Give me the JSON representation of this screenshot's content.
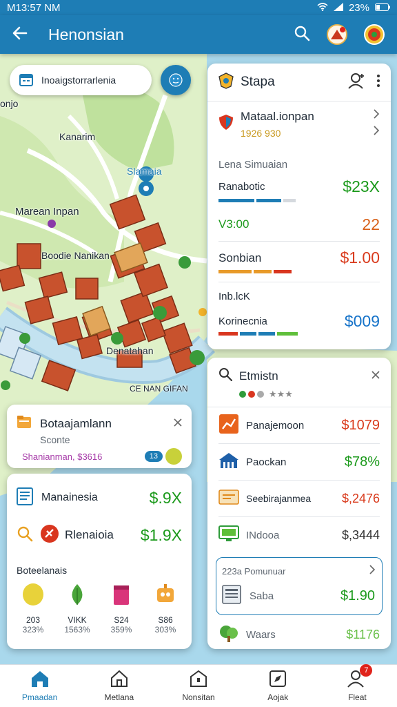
{
  "status_bar": {
    "time": "M13:57 NM",
    "battery": "23%"
  },
  "app_bar": {
    "title": "Henonsian"
  },
  "map": {
    "search_text": "Inoaigstorrarlenia",
    "labels": [
      "onjo",
      "Kanarim",
      "Slamaia",
      "Marean Inpan",
      "Boodie Nanikan",
      "Denatahan",
      "CE NAN GIFAN"
    ]
  },
  "stapa_card": {
    "title": "Stapa",
    "item_title": "Mataal.ionpan",
    "item_sub": "1926 930",
    "section": "Lena Simuaian",
    "rows": [
      {
        "label": "Ranabotic",
        "value": "$23X"
      },
      {
        "label": "V3:00",
        "value": "22"
      },
      {
        "label": "Sonbian",
        "value": "$1.00"
      },
      {
        "label": "Inb.lcK",
        "value": ""
      },
      {
        "label": "Korinecnia",
        "value": "$009"
      }
    ]
  },
  "info_card": {
    "title": "Botaajamlann",
    "subtitle": "Sconte",
    "link": "Shanianman, $3616",
    "badge": "13"
  },
  "bottom_left_card": {
    "rows": [
      {
        "label": "Manainesia",
        "value": "$.9X"
      },
      {
        "label": "Rlenaioia",
        "value": "$1.9X"
      }
    ],
    "section": "Boteelanais",
    "stats": [
      {
        "label": "203",
        "value": "323%"
      },
      {
        "label": "VIKK",
        "value": "1563%"
      },
      {
        "label": "S24",
        "value": "359%"
      },
      {
        "label": "S86",
        "value": "303%"
      }
    ]
  },
  "etmistn_card": {
    "title": "Etmistn",
    "items": [
      {
        "label": "Panajemoon",
        "value": "$1079"
      },
      {
        "label": "Paockan",
        "value": "$78%"
      },
      {
        "label": "Seebirajanmea",
        "value": "$,2476"
      },
      {
        "label": "INdooa",
        "value": "$,3444"
      }
    ],
    "sub_title": "223a Pomunuar",
    "sub_item": "Saba",
    "sub_value": "$1.90",
    "last_item": "Waars",
    "last_value": "$1176"
  },
  "bottom_nav": {
    "items": [
      "Pmaadan",
      "Metlana",
      "Nonsitan",
      "Aojak",
      "Fleat"
    ],
    "badge": "7"
  },
  "colors": {
    "primary": "#1e7db5",
    "green": "#1c9a1c",
    "red": "#d93a1c",
    "blue": "#1673c9"
  }
}
